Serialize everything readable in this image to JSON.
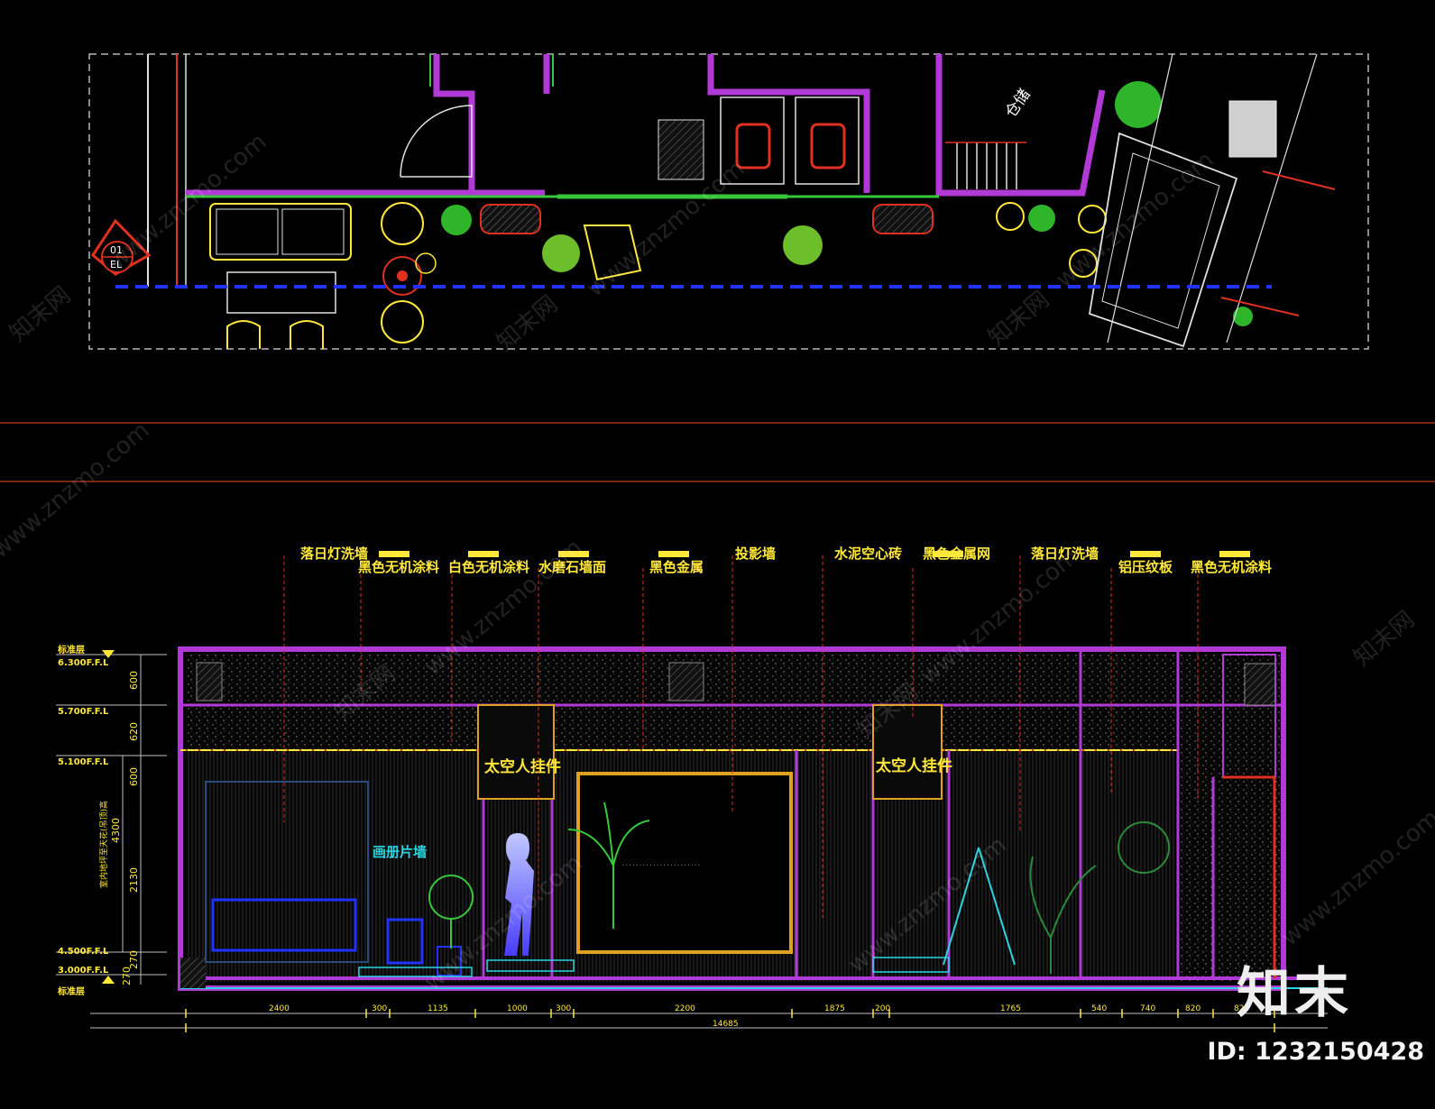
{
  "plan": {
    "marker_top": "01",
    "marker_bottom": "EL",
    "room_label": "仓储"
  },
  "elevation": {
    "callouts": [
      "落日灯洗墙",
      "黑色无机涂料",
      "白色无机涂料",
      "水磨石墙面",
      "黑色金属",
      "投影墙",
      "水泥空心砖",
      "黑色金属网",
      "落日灯洗墙",
      "铝压纹板",
      "黑色无机涂料"
    ],
    "room_labels": {
      "figure_left": "太空人挂件",
      "figure_right": "太空人挂件",
      "wall": "画册片墙"
    },
    "level_markers": [
      "标准层",
      "6.300F.F.L",
      "5.700F.F.L",
      "5.100F.F.L",
      "4.500F.F.L",
      "3.000F.F.L",
      "标准层"
    ],
    "vertical_dims": [
      "600",
      "620",
      "600",
      "4300",
      "2130",
      "270",
      "270"
    ],
    "vertical_note": "室内地坪至天花(吊顶)高",
    "horizontal_dims": [
      "2400",
      "300",
      "1135",
      "1000",
      "300",
      "2200",
      "1875",
      "200",
      "1765",
      "540",
      "740",
      "820",
      "820"
    ],
    "total_dim": "14685"
  },
  "watermarks": {
    "site": "www.znzmo.com",
    "cn": "知末网"
  },
  "branding": {
    "logo": "知末",
    "id": "ID: 1232150428"
  },
  "colors": {
    "background": "#000000",
    "magenta": "#b13ad6",
    "yellow": "#ffe83a",
    "green": "#36c83a",
    "red": "#e03020",
    "blue": "#2233ff",
    "cyan": "#2ad4e0"
  }
}
